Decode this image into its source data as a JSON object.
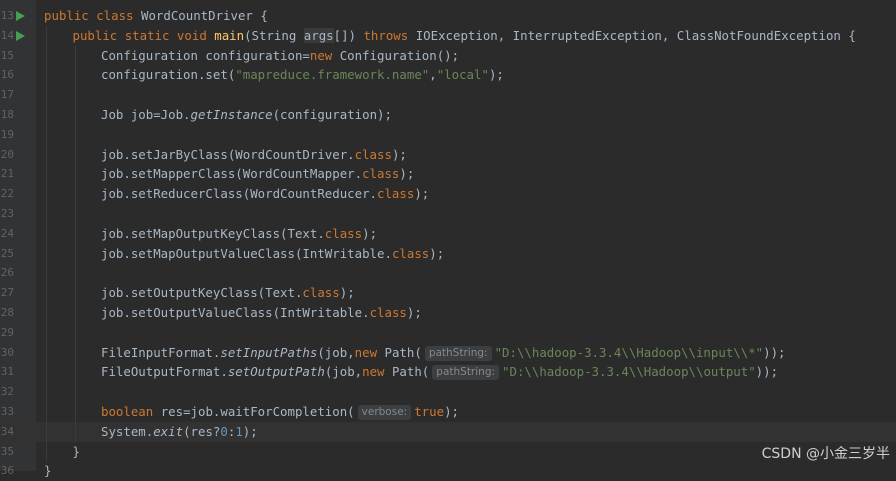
{
  "editor": {
    "lines": [
      {
        "no": "13",
        "run": true,
        "indent": 0,
        "segs": [
          [
            "kw",
            "public class "
          ],
          [
            "",
            "WordCountDriver {"
          ]
        ]
      },
      {
        "no": "14",
        "run": true,
        "indent": 1,
        "segs": [
          [
            "kw",
            "public static void "
          ],
          [
            "fn",
            "main"
          ],
          [
            "",
            "(String "
          ],
          [
            "hl",
            "args"
          ],
          [
            "",
            "[]) "
          ],
          [
            "kw",
            "throws "
          ],
          [
            "",
            "IOException, InterruptedException, ClassNotFoundException {"
          ]
        ]
      },
      {
        "no": "15",
        "indent": 2,
        "segs": [
          [
            "",
            "Configuration configuration="
          ],
          [
            "kw",
            "new "
          ],
          [
            "",
            "Configuration();"
          ]
        ]
      },
      {
        "no": "16",
        "indent": 2,
        "segs": [
          [
            "",
            "configuration.set("
          ],
          [
            "str",
            "\"mapreduce.framework.name\""
          ],
          [
            "",
            ","
          ],
          [
            "str",
            "\"local\""
          ],
          [
            "",
            ");"
          ]
        ]
      },
      {
        "no": "17",
        "indent": 2,
        "segs": []
      },
      {
        "no": "18",
        "indent": 2,
        "segs": [
          [
            "",
            "Job job=Job."
          ],
          [
            "it",
            "getInstance"
          ],
          [
            "",
            "(configuration);"
          ]
        ]
      },
      {
        "no": "19",
        "indent": 2,
        "segs": []
      },
      {
        "no": "20",
        "indent": 2,
        "segs": [
          [
            "",
            "job.setJarByClass(WordCountDriver."
          ],
          [
            "kw",
            "class"
          ],
          [
            "",
            ");"
          ]
        ]
      },
      {
        "no": "21",
        "indent": 2,
        "segs": [
          [
            "",
            "job.setMapperClass(WordCountMapper."
          ],
          [
            "kw",
            "class"
          ],
          [
            "",
            ");"
          ]
        ]
      },
      {
        "no": "22",
        "indent": 2,
        "segs": [
          [
            "",
            "job.setReducerClass(WordCountReducer."
          ],
          [
            "kw",
            "class"
          ],
          [
            "",
            ");"
          ]
        ]
      },
      {
        "no": "23",
        "indent": 2,
        "segs": []
      },
      {
        "no": "24",
        "indent": 2,
        "segs": [
          [
            "",
            "job.setMapOutputKeyClass(Text."
          ],
          [
            "kw",
            "class"
          ],
          [
            "",
            ");"
          ]
        ]
      },
      {
        "no": "25",
        "indent": 2,
        "segs": [
          [
            "",
            "job.setMapOutputValueClass(IntWritable."
          ],
          [
            "kw",
            "class"
          ],
          [
            "",
            ");"
          ]
        ]
      },
      {
        "no": "26",
        "indent": 2,
        "segs": []
      },
      {
        "no": "27",
        "indent": 2,
        "segs": [
          [
            "",
            "job.setOutputKeyClass(Text."
          ],
          [
            "kw",
            "class"
          ],
          [
            "",
            ");"
          ]
        ]
      },
      {
        "no": "28",
        "indent": 2,
        "segs": [
          [
            "",
            "job.setOutputValueClass(IntWritable."
          ],
          [
            "kw",
            "class"
          ],
          [
            "",
            ");"
          ]
        ]
      },
      {
        "no": "29",
        "indent": 2,
        "segs": []
      },
      {
        "no": "30",
        "indent": 2,
        "segs": [
          [
            "",
            "FileInputFormat."
          ],
          [
            "it",
            "setInputPaths"
          ],
          [
            "",
            "(job,"
          ],
          [
            "kw",
            "new "
          ],
          [
            "",
            "Path("
          ],
          [
            "hint",
            "pathString:"
          ],
          [
            "str",
            "\"D:\\\\hadoop-3.3.4\\\\Hadoop\\\\input\\\\*\""
          ],
          [
            "",
            "));"
          ]
        ]
      },
      {
        "no": "31",
        "indent": 2,
        "segs": [
          [
            "",
            "FileOutputFormat."
          ],
          [
            "it",
            "setOutputPath"
          ],
          [
            "",
            "(job,"
          ],
          [
            "kw",
            "new "
          ],
          [
            "",
            "Path("
          ],
          [
            "hint",
            "pathString:"
          ],
          [
            "str",
            "\"D:\\\\hadoop-3.3.4\\\\Hadoop\\\\output\""
          ],
          [
            "",
            "));"
          ]
        ]
      },
      {
        "no": "32",
        "indent": 2,
        "segs": []
      },
      {
        "no": "33",
        "indent": 2,
        "segs": [
          [
            "kw",
            "boolean "
          ],
          [
            "",
            "res=job.waitForCompletion("
          ],
          [
            "hint",
            "verbose:"
          ],
          [
            "kw",
            "true"
          ],
          [
            "",
            ");"
          ]
        ]
      },
      {
        "no": "34",
        "indent": 2,
        "current": true,
        "segs": [
          [
            "",
            "System."
          ],
          [
            "it",
            "exit"
          ],
          [
            "",
            "(res?"
          ],
          [
            "num",
            "0"
          ],
          [
            "",
            ":"
          ],
          [
            "num",
            "1"
          ],
          [
            "",
            ");"
          ]
        ]
      },
      {
        "no": "35",
        "indent": 1,
        "segs": [
          [
            "",
            "}"
          ]
        ]
      },
      {
        "no": "36",
        "indent": 0,
        "segs": [
          [
            "",
            "}"
          ]
        ]
      }
    ]
  },
  "watermark": "CSDN @小金三岁半"
}
